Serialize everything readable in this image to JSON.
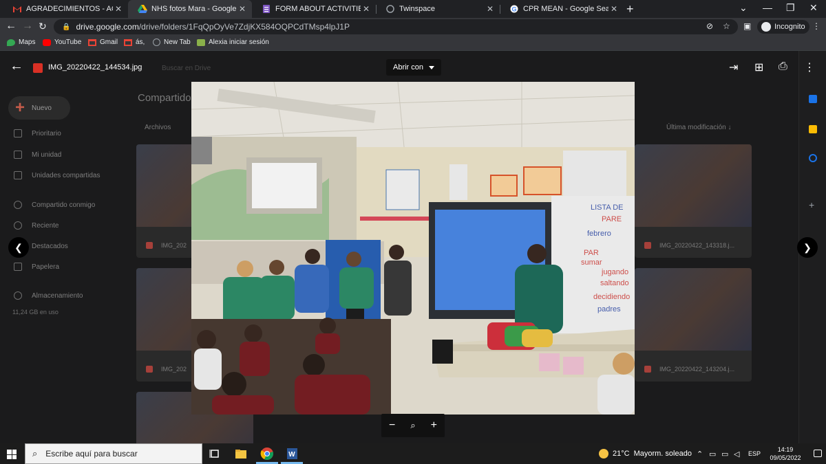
{
  "browser": {
    "tabs": [
      {
        "title": "AGRADECIMIENTOS - ACKNOWL",
        "favicon": "gmail-icon",
        "active": false
      },
      {
        "title": "NHS fotos Mara - Google Drive",
        "favicon": "google-drive-icon",
        "active": true
      },
      {
        "title": "FORM ABOUT ACTIVITIES CARRIE",
        "favicon": "google-forms-icon",
        "active": false
      },
      {
        "title": "Twinspace",
        "favicon": "twinspace-icon",
        "active": false
      },
      {
        "title": "CPR MEAN - Google Search",
        "favicon": "google-icon",
        "active": false
      }
    ],
    "new_tab": "+",
    "url_host": "drive.google.com",
    "url_path": "/drive/folders/1FqQpOyVe7ZdjKX584OQPCdTMsp4lpJ1P",
    "incognito_label": "Incognito",
    "bookmarks": [
      {
        "label": "Maps",
        "icon": "maps-icon",
        "color": "#34a853"
      },
      {
        "label": "YouTube",
        "icon": "youtube-icon",
        "color": "#ff0000"
      },
      {
        "label": "Gmail",
        "icon": "gmail-icon",
        "color": "#ea4335"
      },
      {
        "label": "ás,",
        "icon": "gmail-icon",
        "color": "#ea4335"
      },
      {
        "label": "New Tab",
        "icon": "globe-icon",
        "color": "#9aa0a6"
      },
      {
        "label": "Alexia iniciar sesión",
        "icon": "alexia-icon",
        "color": "#8ab04a"
      }
    ]
  },
  "drive": {
    "new_button": "Nuevo",
    "sidebar": [
      {
        "label": "Prioritario"
      },
      {
        "label": "Mi unidad"
      },
      {
        "label": "Unidades compartidas"
      },
      {
        "label": "Compartido conmigo"
      },
      {
        "label": "Reciente"
      },
      {
        "label": "Destacados"
      },
      {
        "label": "Papelera"
      },
      {
        "label": "Almacenamiento"
      }
    ],
    "storage_used": "11,24 GB en uso",
    "main_title": "Compartido",
    "files_label": "Archivos",
    "sort_label": "Última modificación",
    "thumbnails": [
      {
        "name": "IMG_202"
      },
      {
        "name": "IMG_20220422_143318.j..."
      },
      {
        "name": "IMG_202"
      },
      {
        "name": "IMG_20220422_143204.j..."
      }
    ],
    "search_ghost": "Buscar en Drive"
  },
  "viewer": {
    "file_name": "IMG_20220422_144534.jpg",
    "open_with": "Abrir con",
    "zoom_out": "−",
    "zoom_icon": "magnifier-icon",
    "zoom_in": "+",
    "board_text": [
      "LISTA DE",
      "PARE",
      "febrero",
      "PAR",
      "sumar",
      "jugando",
      "saltando",
      "decidiendo",
      "padres"
    ]
  },
  "taskbar": {
    "search_placeholder": "Escribe aquí para buscar",
    "weather_temp": "21°C",
    "weather_text": "Mayorm. soleado",
    "language": "ESP",
    "time": "14:19",
    "date": "09/05/2022"
  }
}
